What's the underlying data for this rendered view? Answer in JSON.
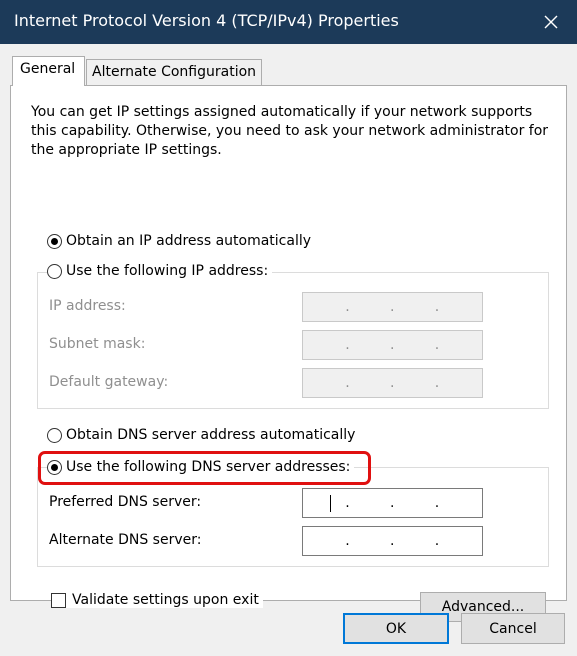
{
  "window": {
    "title": "Internet Protocol Version 4 (TCP/IPv4) Properties",
    "close_icon": "close-icon"
  },
  "tabs": [
    {
      "label": "General",
      "active": true
    },
    {
      "label": "Alternate Configuration",
      "active": false
    }
  ],
  "description": "You can get IP settings assigned automatically if your network supports this capability. Otherwise, you need to ask your network administrator for the appropriate IP settings.",
  "ip_options": {
    "auto": {
      "label": "Obtain an IP address automatically",
      "checked": true
    },
    "manual": {
      "label": "Use the following IP address:",
      "checked": false
    }
  },
  "ip_fields": [
    {
      "label": "IP address:",
      "value": ". . .",
      "enabled": false
    },
    {
      "label": "Subnet mask:",
      "value": ". . .",
      "enabled": false
    },
    {
      "label": "Default gateway:",
      "value": ". . .",
      "enabled": false
    }
  ],
  "dns_options": {
    "auto": {
      "label": "Obtain DNS server address automatically",
      "checked": false
    },
    "manual": {
      "label": "Use the following DNS server addresses:",
      "checked": true,
      "highlight_color": "#e01010"
    }
  },
  "dns_fields": [
    {
      "label": "Preferred DNS server:",
      "value": ". . .",
      "enabled": true,
      "focused": true
    },
    {
      "label": "Alternate DNS server:",
      "value": ". . .",
      "enabled": true,
      "focused": false
    }
  ],
  "validate": {
    "label": "Validate settings upon exit",
    "checked": false
  },
  "buttons": {
    "advanced": "Advanced...",
    "ok": "OK",
    "cancel": "Cancel"
  },
  "colors": {
    "titlebar": "#1c3a59",
    "accent": "#0078d7",
    "highlight": "#e01010"
  }
}
